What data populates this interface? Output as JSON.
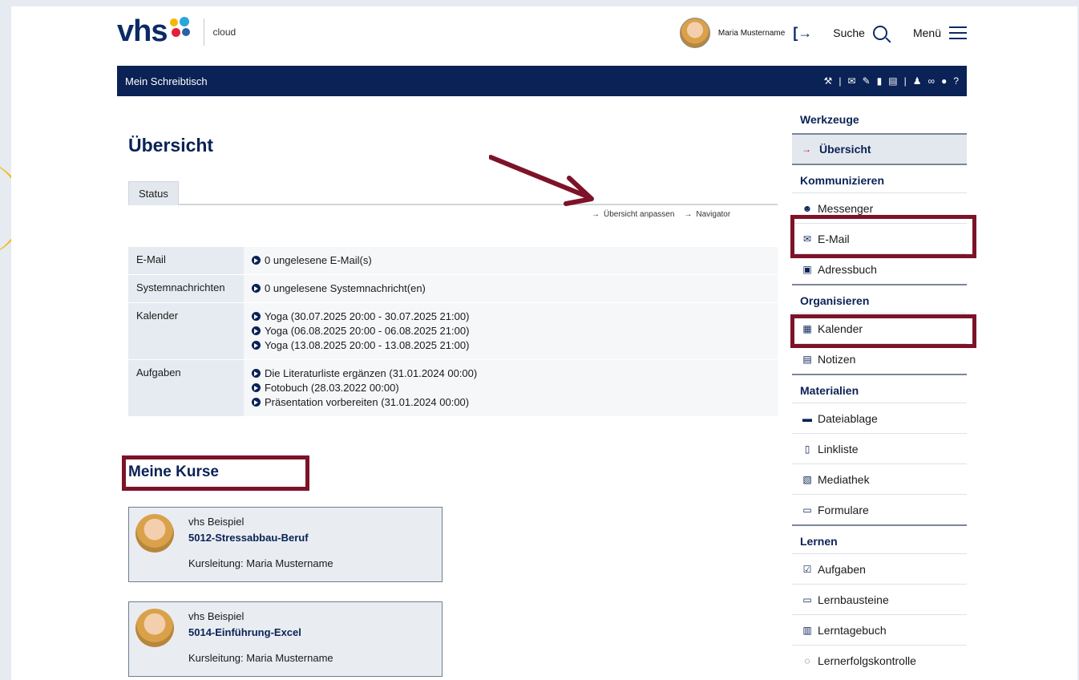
{
  "header": {
    "logo_text": "vhs",
    "logo_suffix": "cloud",
    "username": "Maria Mustername",
    "search_label": "Suche",
    "menu_label": "Menü"
  },
  "navbar": {
    "title": "Mein Schreibtisch",
    "icons": [
      "toolbox-icon",
      "mail-icon",
      "edit-icon",
      "bookmark-icon",
      "notes-icon",
      "user-icon",
      "link-icon",
      "chat-icon",
      "help-icon"
    ]
  },
  "main": {
    "title": "Übersicht",
    "tab_status": "Status",
    "link_customize": "Übersicht anpassen",
    "link_navigator": "Navigator",
    "rows": [
      {
        "label": "E-Mail",
        "lines": [
          "0 ungelesene E-Mail(s)"
        ]
      },
      {
        "label": "Systemnachrichten",
        "lines": [
          "0 ungelesene Systemnachricht(en)"
        ]
      },
      {
        "label": "Kalender",
        "lines": [
          "Yoga (30.07.2025 20:00 - 30.07.2025 21:00)",
          "Yoga (06.08.2025 20:00 - 06.08.2025 21:00)",
          "Yoga (13.08.2025 20:00 - 13.08.2025 21:00)"
        ]
      },
      {
        "label": "Aufgaben",
        "lines": [
          "Die Literaturliste ergänzen (31.01.2024 00:00)",
          "Fotobuch (28.03.2022 00:00)",
          "Präsentation vorbereiten (31.01.2024 00:00)"
        ]
      }
    ],
    "courses_title": "Meine Kurse",
    "courses": [
      {
        "org": "vhs Beispiel",
        "name": "5012-Stressabbau-Beruf",
        "lead": "Kursleitung: Maria Mustername"
      },
      {
        "org": "vhs Beispiel",
        "name": "5014-Einführung-Excel",
        "lead": "Kursleitung: Maria Mustername"
      }
    ]
  },
  "sidebar": {
    "werkzeuge": "Werkzeuge",
    "uebersicht": "Übersicht",
    "kommunizieren": "Kommunizieren",
    "messenger": "Messenger",
    "email": "E-Mail",
    "adressbuch": "Adressbuch",
    "organisieren": "Organisieren",
    "kalender": "Kalender",
    "notizen": "Notizen",
    "materialien": "Materialien",
    "dateiablage": "Dateiablage",
    "linkliste": "Linkliste",
    "mediathek": "Mediathek",
    "formulare": "Formulare",
    "lernen": "Lernen",
    "aufgaben": "Aufgaben",
    "lernbausteine": "Lernbausteine",
    "lerntagebuch": "Lerntagebuch",
    "lernerfolgskontrolle": "Lernerfolgskontrolle"
  },
  "colors": {
    "navy": "#0a2255",
    "highlight": "#7d1328",
    "accent_yellow": "#f5b800"
  }
}
